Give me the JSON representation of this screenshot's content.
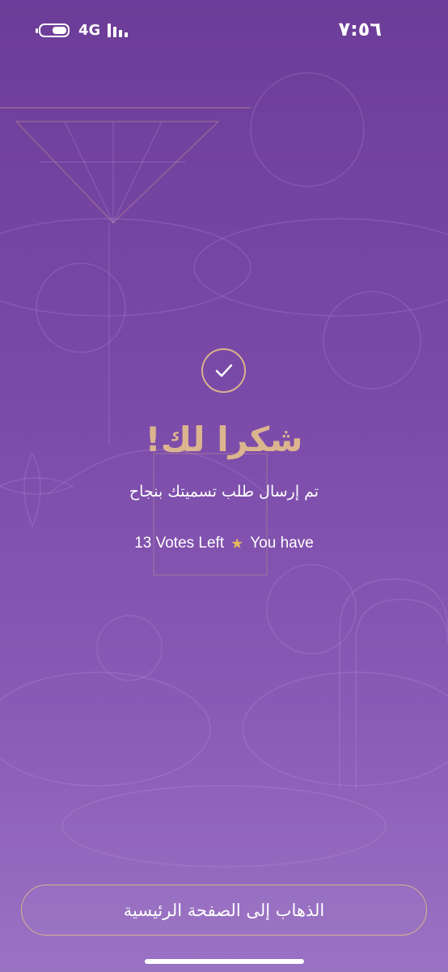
{
  "status_bar": {
    "time": "٧:٥٦",
    "network": "4G",
    "battery_level": 0.5
  },
  "confirmation": {
    "icon": "checkmark-icon",
    "title": "شكرا لك!",
    "message": "تم إرسال طلب تسميتك بنجاح",
    "votes_prefix": "You have",
    "votes_suffix": "13 Votes Left",
    "votes_icon": "star-icon"
  },
  "actions": {
    "home_button_label": "الذهاب إلى الصفحة الرئيسية"
  },
  "colors": {
    "background": "#7a4aa8",
    "accent_gold": "#dcb58f",
    "star": "#e3b75e"
  }
}
